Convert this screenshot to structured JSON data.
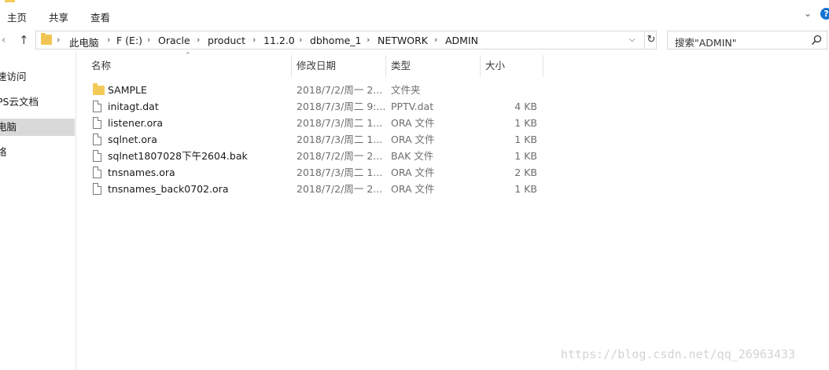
{
  "ribbon": {
    "tabs": [
      "主页",
      "共享",
      "查看"
    ],
    "expand_icon": "chevron-down-icon",
    "help_icon": "help-icon"
  },
  "nav": {
    "back_icon": "chevron-right-icon",
    "up_icon": "arrow-up-icon",
    "breadcrumbs": [
      "此电脑",
      "F (E:)",
      "Oracle",
      "product",
      "11.2.0",
      "dbhome_1",
      "NETWORK",
      "ADMIN"
    ],
    "separator": "›",
    "dropdown_icon": "chevron-down-icon",
    "refresh_icon": "refresh-icon"
  },
  "search": {
    "placeholder": "搜索\"ADMIN\""
  },
  "sidebar": {
    "items": [
      {
        "label": "速访问",
        "selected": false
      },
      {
        "label": "PS云文档",
        "selected": false
      },
      {
        "label": "电脑",
        "selected": true
      },
      {
        "label": "络",
        "selected": false
      }
    ]
  },
  "columns": {
    "name": "名称",
    "date": "修改日期",
    "type": "类型",
    "size": "大小"
  },
  "files": [
    {
      "name": "SAMPLE",
      "date": "2018/7/2/周一 2...",
      "type": "文件夹",
      "size": "",
      "icon": "folder-icon"
    },
    {
      "name": "initagt.dat",
      "date": "2018/7/3/周二 9:...",
      "type": "PPTV.dat",
      "size": "4 KB",
      "icon": "file-icon"
    },
    {
      "name": "listener.ora",
      "date": "2018/7/3/周二 1...",
      "type": "ORA 文件",
      "size": "1 KB",
      "icon": "file-icon"
    },
    {
      "name": "sqlnet.ora",
      "date": "2018/7/3/周二 1...",
      "type": "ORA 文件",
      "size": "1 KB",
      "icon": "file-icon"
    },
    {
      "name": "sqlnet1807028下午2604.bak",
      "date": "2018/7/2/周一 2...",
      "type": "BAK 文件",
      "size": "1 KB",
      "icon": "file-icon"
    },
    {
      "name": "tnsnames.ora",
      "date": "2018/7/3/周二 1...",
      "type": "ORA 文件",
      "size": "2 KB",
      "icon": "file-icon"
    },
    {
      "name": "tnsnames_back0702.ora",
      "date": "2018/7/2/周一 2...",
      "type": "ORA 文件",
      "size": "1 KB",
      "icon": "file-icon"
    }
  ],
  "watermark": "https://blog.csdn.net/qq_26963433",
  "colors": {
    "folder": "#f4c957",
    "selection": "#d9d9d9",
    "help": "#1572d2"
  }
}
